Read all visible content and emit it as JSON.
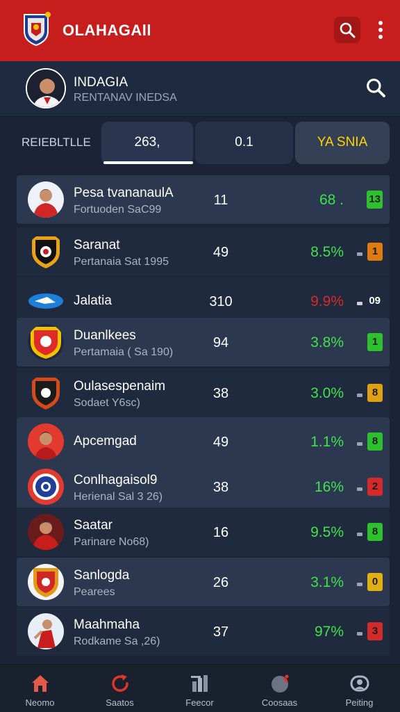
{
  "header": {
    "title": "OLAHAGAll",
    "icons": [
      "team-crest-icon",
      "search-icon",
      "more-vertical-icon"
    ],
    "bg_color": "#c81d1d"
  },
  "profile": {
    "name": "INDAGIA",
    "subtitle": "RENTANAV INEDSA"
  },
  "filter": {
    "label": "REIEBLTLLE",
    "segments": [
      {
        "label": "263,",
        "selected": true
      },
      {
        "label": "0.1",
        "selected": false
      },
      {
        "label": "YA SNIA",
        "selected": false
      }
    ]
  },
  "rows": [
    {
      "name": "Pesa tvananaulA",
      "sub": "Fortuoden SaC99",
      "count": "11",
      "pct": "68 .",
      "pct_color": "#3fe24a",
      "badge": "13",
      "badge_color": "#2ec12e",
      "trend": ""
    },
    {
      "name": "Saranat",
      "sub": "Pertanaia Sat 1995",
      "count": "49",
      "pct": "8.5%",
      "pct_color": "#3fe24a",
      "badge": "1",
      "badge_color": "#e07b12",
      "trend": "neutral"
    },
    {
      "name": "Jalatia",
      "sub": "",
      "count": "310",
      "pct": "9.9%",
      "pct_color": "#d42a2a",
      "badge": "09",
      "badge_color": "none",
      "trend": "down"
    },
    {
      "name": "Duanlkees",
      "sub": "Pertamaia ( Sa 190)",
      "count": "94",
      "pct": "3.8%",
      "pct_color": "#3fe24a",
      "badge": "1",
      "badge_color": "#2ec12e",
      "trend": ""
    },
    {
      "name": "Oulasespenaim",
      "sub": "Sodaet Y6sc)",
      "count": "38",
      "pct": "3.0%",
      "pct_color": "#3fe24a",
      "badge": "8",
      "badge_color": "#e0a012",
      "trend": "neutral"
    },
    {
      "name": "Apcemgad",
      "sub": "",
      "count": "49",
      "pct": "1.1%",
      "pct_color": "#3fe24a",
      "badge": "8",
      "badge_color": "#2ec12e",
      "trend": "up"
    },
    {
      "name": "Conlhagaisol9",
      "sub": "Herienal Sal 3 26)",
      "count": "38",
      "pct": "16%",
      "pct_color": "#3fe24a",
      "badge": "2",
      "badge_color": "#d42a2a",
      "trend": "up"
    },
    {
      "name": "Saatar",
      "sub": "Parinare No68)",
      "count": "16",
      "pct": "9.5%",
      "pct_color": "#3fe24a",
      "badge": "8",
      "badge_color": "#2ec12e",
      "trend": "neutral"
    },
    {
      "name": "Sanlogda",
      "sub": "Pearees",
      "count": "26",
      "pct": "3.1%",
      "pct_color": "#3fe24a",
      "badge": "0",
      "badge_color": "#e0b012",
      "trend": "up"
    },
    {
      "name": "Maahmaha",
      "sub": "Rodkame Sa ,26)",
      "count": "37",
      "pct": "97%",
      "pct_color": "#3fe24a",
      "badge": "3",
      "badge_color": "#d42a2a",
      "trend": "neutral"
    }
  ],
  "nav": [
    {
      "label": "Neomo",
      "icon": "home-icon"
    },
    {
      "label": "Saatos",
      "icon": "refresh-icon"
    },
    {
      "label": "Feecor",
      "icon": "stats-icon"
    },
    {
      "label": "Coosaas",
      "icon": "ball-icon"
    },
    {
      "label": "Peiting",
      "icon": "profile-icon"
    }
  ]
}
